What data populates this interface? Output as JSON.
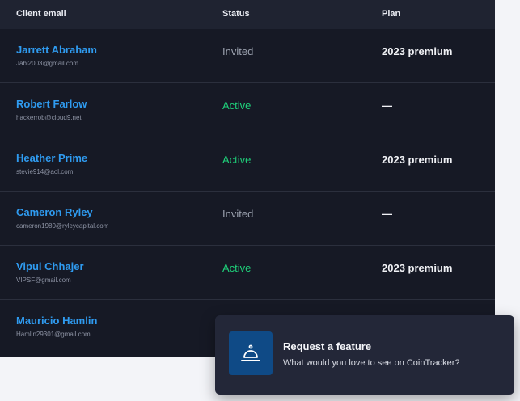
{
  "table": {
    "headers": {
      "email": "Client email",
      "status": "Status",
      "plan": "Plan"
    },
    "rows": [
      {
        "name": "Jarrett Abraham",
        "email": "Jabi2003@gmail.com",
        "status": "Invited",
        "plan": "2023 premium"
      },
      {
        "name": "Robert Farlow",
        "email": "hackerrob@cloud9.net",
        "status": "Active",
        "plan": "—"
      },
      {
        "name": "Heather Prime",
        "email": "stevie914@aol.com",
        "status": "Active",
        "plan": "2023 premium"
      },
      {
        "name": "Cameron Ryley",
        "email": "cameron1980@ryleycapital.com",
        "status": "Invited",
        "plan": "—"
      },
      {
        "name": "Vipul Chhajer",
        "email": "VIPSF@gmail.com",
        "status": "Active",
        "plan": "2023 premium"
      },
      {
        "name": "Mauricio Hamlin",
        "email": "Hamlin29301@gmail.com",
        "status": "",
        "plan": ""
      }
    ]
  },
  "toast": {
    "icon": "service-bell-icon",
    "title": "Request a feature",
    "text": "What would you love to see on CoinTracker?"
  },
  "colors": {
    "table_bg": "#161925",
    "header_bg": "#1f2331",
    "name": "#2f9bf0",
    "active": "#1fd07a",
    "invited": "#9aa0ad",
    "toast_bg": "#232738",
    "icon_bg": "#0f4a86"
  }
}
